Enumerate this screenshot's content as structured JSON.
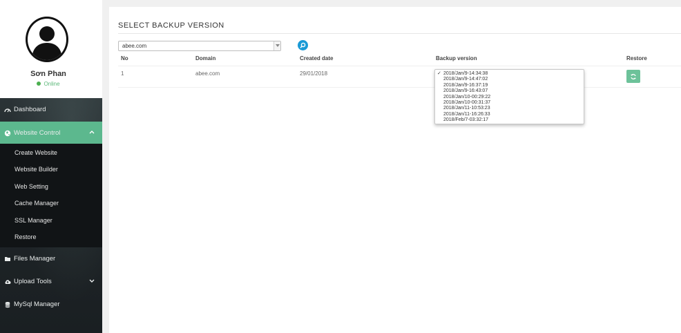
{
  "user": {
    "name": "Sơn Phan",
    "status": "Online"
  },
  "nav": {
    "dashboard": "Dashboard",
    "website_control": "Website Control",
    "sub_items": [
      "Create Website",
      "Website Builder",
      "Web Setting",
      "Cache Manager",
      "SSL Manager",
      "Restore"
    ],
    "files_manager": "Files Manager",
    "upload_tools": "Upload Tools",
    "mysql_manager": "MySql Manager"
  },
  "page": {
    "title": "SELECT BACKUP VERSION",
    "domain_value": "abee.com"
  },
  "table": {
    "headers": [
      "No",
      "Domain",
      "Created date",
      "Backup version",
      "Restore"
    ],
    "rows": [
      {
        "no": "1",
        "domain": "abee.com",
        "created": "29/01/2018"
      }
    ]
  },
  "backup_versions": {
    "selected": "2018/Jan/9-14:34:38",
    "options": [
      "2018/Jan/9-14:34:38",
      "2018/Jan/9-14:47:02",
      "2018/Jan/9-16:37:19",
      "2018/Jan/9-16:43:07",
      "2018/Jan/10-00:29:22",
      "2018/Jan/10-00:31:37",
      "2018/Jan/11-10:53:23",
      "2018/Jan/11-16:26:33",
      "2018/Feb/7-03:32:17"
    ]
  },
  "colors": {
    "accent": "#5cb88e",
    "search": "#1a9ad6",
    "online": "#4caf50",
    "sidebar_dark": "#1d2226"
  },
  "icons": {
    "dashboard": "speedometer-icon",
    "website_control": "globe-icon",
    "files_manager": "folder-icon",
    "upload_tools": "cloud-upload-icon",
    "mysql_manager": "database-icon",
    "search": "search-icon",
    "restore": "refresh-icon"
  }
}
